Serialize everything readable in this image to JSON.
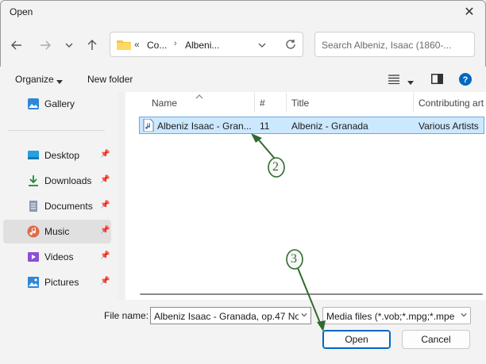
{
  "window": {
    "title": "Open"
  },
  "address": {
    "folder_icon": "folder-icon",
    "overflow": "«",
    "crumbs": [
      "Co...",
      "Albeni..."
    ]
  },
  "search": {
    "placeholder": "Search Albeniz, Isaac (1860-..."
  },
  "toolbar": {
    "organize": "Organize",
    "new_folder": "New folder"
  },
  "sidebar": {
    "items": [
      {
        "label": "Gallery",
        "icon": "gallery-icon",
        "pinned": false,
        "selected": false
      },
      {
        "label": "Desktop",
        "icon": "desktop-icon",
        "pinned": true,
        "selected": false
      },
      {
        "label": "Downloads",
        "icon": "download-icon",
        "pinned": true,
        "selected": false
      },
      {
        "label": "Documents",
        "icon": "documents-icon",
        "pinned": true,
        "selected": false
      },
      {
        "label": "Music",
        "icon": "music-icon",
        "pinned": true,
        "selected": true
      },
      {
        "label": "Videos",
        "icon": "videos-icon",
        "pinned": true,
        "selected": false
      },
      {
        "label": "Pictures",
        "icon": "pictures-icon",
        "pinned": true,
        "selected": false
      }
    ]
  },
  "file_list": {
    "columns": [
      "Name",
      "#",
      "Title",
      "Contributing art"
    ],
    "rows": [
      {
        "name": "Albeniz Isaac - Gran...",
        "number": "11",
        "title": "Albeniz - Granada",
        "artist": "Various Artists",
        "icon": "music-file-icon",
        "selected": true
      }
    ]
  },
  "footer": {
    "file_name_label": "File name:",
    "file_name_value": "Albeniz Isaac - Granada, op.47 No",
    "file_type": "Media files (*.vob;*.mpg;*.mpe",
    "open_label": "Open",
    "cancel_label": "Cancel"
  },
  "annotations": {
    "step2": "2",
    "step3": "3",
    "color": "#2f6b2f"
  }
}
